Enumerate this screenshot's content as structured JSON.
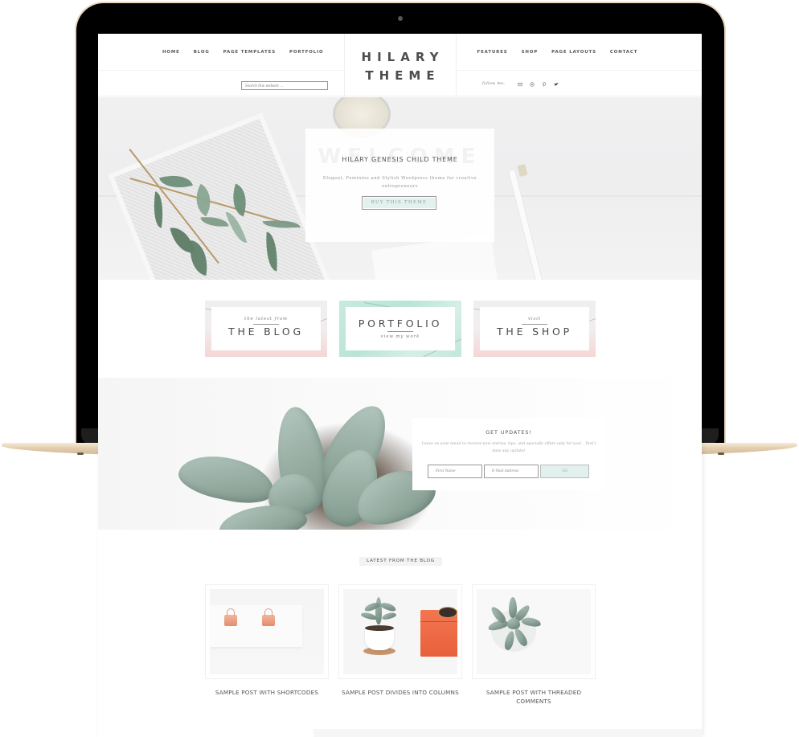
{
  "header": {
    "nav_left": [
      "HOME",
      "BLOG",
      "PAGE TEMPLATES",
      "PORTFOLIO"
    ],
    "nav_right": [
      "FEATURES",
      "SHOP",
      "PAGE LAYOUTS",
      "CONTACT"
    ],
    "logo_line1": "HILARY",
    "logo_line2": "THEME",
    "search_placeholder": "Search this website ...",
    "follow_label": "follow me:",
    "social_icons": [
      "email-icon",
      "instagram-icon",
      "pinterest-icon",
      "twitter-icon"
    ]
  },
  "hero": {
    "ghost_text": "WELCOME",
    "title": "HILARY GENESIS CHILD THEME",
    "subtitle": "Elegant, Feminine and Stylish Wordpress theme for creative entrepreneurs",
    "button_label": "BUY THIS THEME"
  },
  "promos": [
    {
      "small_top": "the latest from",
      "big": "THE BLOG",
      "small_bottom": ""
    },
    {
      "small_top": "",
      "big": "PORTFOLIO",
      "small_bottom": "view my work"
    },
    {
      "small_top": "visit",
      "big": "THE SHOP",
      "small_bottom": ""
    }
  ],
  "subscribe": {
    "title": "GET UPDATES!",
    "text": "Leave us your email to receive new entries, tips, and specially offers only for you! . Don't miss any update!",
    "first_name_placeholder": "First Name",
    "email_placeholder": "E-Mail Address",
    "go_label": "GO"
  },
  "latest": {
    "label": "LATEST FROM THE BLOG",
    "posts": [
      {
        "title": "SAMPLE POST WITH SHORTCODES"
      },
      {
        "title": "SAMPLE POST DIVIDES INTO COLUMNS"
      },
      {
        "title": "SAMPLE POST WITH THREADED COMMENTS"
      }
    ]
  },
  "colors": {
    "accent_mint": "#e2f0ee",
    "text_dark": "#4d4d4d",
    "frame_gold": "#e2ccac",
    "promo_pink": "#f4d6d5",
    "promo_mint": "#c8ebdf"
  }
}
